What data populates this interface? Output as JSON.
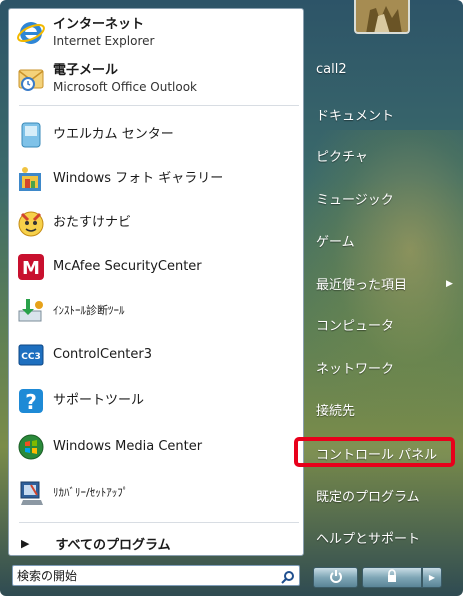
{
  "left": {
    "programs": [
      {
        "name": "インターネット",
        "sub": "Internet Explorer",
        "icon": "internet-explorer-icon"
      },
      {
        "name": "電子メール",
        "sub": "Microsoft Office Outlook",
        "icon": "outlook-mail-icon"
      },
      {
        "name": "ウエルカム センター",
        "icon": "welcome-center-icon"
      },
      {
        "name": "Windows フォト ギャラリー",
        "icon": "photo-gallery-icon"
      },
      {
        "name": "おたすけナビ",
        "icon": "otasuke-navi-icon"
      },
      {
        "name": "McAfee SecurityCenter",
        "icon": "mcafee-icon"
      },
      {
        "name": "ｲﾝｽﾄｰﾙ診断ﾂｰﾙ",
        "icon": "install-diagnostic-icon"
      },
      {
        "name": "ControlCenter3",
        "icon": "controlcenter3-icon"
      },
      {
        "name": "サポートツール",
        "icon": "help-question-icon"
      },
      {
        "name": "Windows Media Center",
        "icon": "media-center-icon"
      },
      {
        "name": "ﾘｶﾊﾞﾘｰ/ｾｯﾄｱｯﾌﾟ",
        "icon": "recovery-setup-icon"
      }
    ],
    "all_programs": "すべてのプログラム",
    "all_programs_arrow": "▶"
  },
  "search": {
    "placeholder": "検索の開始"
  },
  "right": {
    "items": [
      "call2",
      "ドキュメント",
      "ピクチャ",
      "ミュージック",
      "ゲーム",
      "最近使った項目",
      "コンピュータ",
      "ネットワーク",
      "接続先",
      "コントロール パネル",
      "既定のプログラム",
      "ヘルプとサポート"
    ],
    "recent_arrow": "▶"
  },
  "colors": {
    "highlight": "#e8001b"
  }
}
